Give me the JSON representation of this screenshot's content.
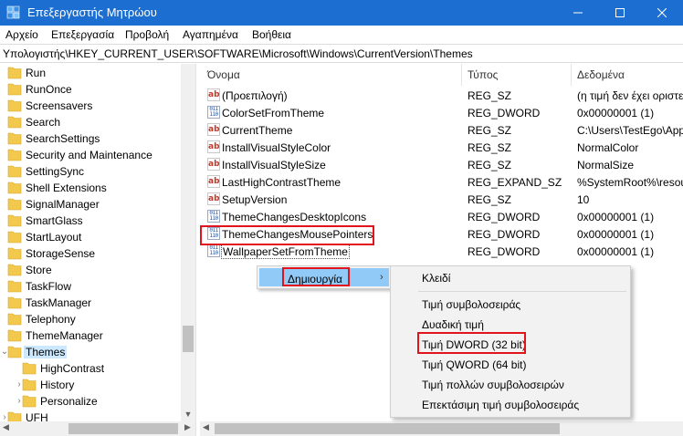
{
  "window": {
    "title": "Επεξεργαστής Μητρώου",
    "controls": {
      "minimize": "—",
      "maximize": "☐",
      "close": "✕"
    }
  },
  "menu": [
    "Αρχείο",
    "Επεξεργασία",
    "Προβολή",
    "Αγαπημένα",
    "Βοήθεια"
  ],
  "address": "Υπολογιστής\\HKEY_CURRENT_USER\\SOFTWARE\\Microsoft\\Windows\\CurrentVersion\\Themes",
  "tree": {
    "items": [
      {
        "label": "Run",
        "level": 0,
        "expander": ""
      },
      {
        "label": "RunOnce",
        "level": 0,
        "expander": ""
      },
      {
        "label": "Screensavers",
        "level": 0,
        "expander": ""
      },
      {
        "label": "Search",
        "level": 0,
        "expander": ""
      },
      {
        "label": "SearchSettings",
        "level": 0,
        "expander": ""
      },
      {
        "label": "Security and Maintenance",
        "level": 0,
        "expander": ""
      },
      {
        "label": "SettingSync",
        "level": 0,
        "expander": ""
      },
      {
        "label": "Shell Extensions",
        "level": 0,
        "expander": ""
      },
      {
        "label": "SignalManager",
        "level": 0,
        "expander": ""
      },
      {
        "label": "SmartGlass",
        "level": 0,
        "expander": ""
      },
      {
        "label": "StartLayout",
        "level": 0,
        "expander": ""
      },
      {
        "label": "StorageSense",
        "level": 0,
        "expander": ""
      },
      {
        "label": "Store",
        "level": 0,
        "expander": ""
      },
      {
        "label": "TaskFlow",
        "level": 0,
        "expander": ""
      },
      {
        "label": "TaskManager",
        "level": 0,
        "expander": ""
      },
      {
        "label": "Telephony",
        "level": 0,
        "expander": ""
      },
      {
        "label": "ThemeManager",
        "level": 0,
        "expander": ""
      },
      {
        "label": "Themes",
        "level": 0,
        "expander": "⌄",
        "selected": true
      },
      {
        "label": "HighContrast",
        "level": 1,
        "expander": ""
      },
      {
        "label": "History",
        "level": 1,
        "expander": "›"
      },
      {
        "label": "Personalize",
        "level": 1,
        "expander": "›"
      },
      {
        "label": "UFH",
        "level": 0,
        "expander": "›"
      }
    ]
  },
  "columns": {
    "name": "Όνομα",
    "type": "Τύπος",
    "data": "Δεδομένα"
  },
  "values": [
    {
      "icon": "string",
      "name": "(Προεπιλογή)",
      "type": "REG_SZ",
      "data": "(η τιμή δεν έχει οριστεί)"
    },
    {
      "icon": "binary",
      "name": "ColorSetFromTheme",
      "type": "REG_DWORD",
      "data": "0x00000001 (1)"
    },
    {
      "icon": "string",
      "name": "CurrentTheme",
      "type": "REG_SZ",
      "data": "C:\\Users\\TestEgo\\AppData"
    },
    {
      "icon": "string",
      "name": "InstallVisualStyleColor",
      "type": "REG_SZ",
      "data": "NormalColor"
    },
    {
      "icon": "string",
      "name": "InstallVisualStyleSize",
      "type": "REG_SZ",
      "data": "NormalSize"
    },
    {
      "icon": "string",
      "name": "LastHighContrastTheme",
      "type": "REG_EXPAND_SZ",
      "data": "%SystemRoot%\\resources"
    },
    {
      "icon": "string",
      "name": "SetupVersion",
      "type": "REG_SZ",
      "data": "10"
    },
    {
      "icon": "binary",
      "name": "ThemeChangesDesktopIcons",
      "type": "REG_DWORD",
      "data": "0x00000001 (1)"
    },
    {
      "icon": "binary",
      "name": "ThemeChangesMousePointers",
      "type": "REG_DWORD",
      "data": "0x00000001 (1)",
      "highlighted": true
    },
    {
      "icon": "binary",
      "name": "WallpaperSetFromTheme",
      "type": "REG_DWORD",
      "data": "0x00000001 (1)",
      "focused": true
    }
  ],
  "context_menu": {
    "new_label": "Δημιουργία",
    "submenu": [
      {
        "label": "Κλειδί"
      },
      {
        "label": "Τιμή συμβολοσειράς"
      },
      {
        "label": "Δυαδική τιμή"
      },
      {
        "label": "Τιμή DWORD (32 bit)",
        "highlighted": true
      },
      {
        "label": "Τιμή QWORD (64 bit)"
      },
      {
        "label": "Τιμή πολλών συμβολοσειρών"
      },
      {
        "label": "Επεκτάσιμη τιμή συμβολοσειράς"
      }
    ]
  },
  "colors": {
    "titlebar": "#1c6fd1",
    "selection": "#cce8ff",
    "menu_highlight": "#91c9f7",
    "annotation_red": "#e0141a",
    "folder": "#f2c94c"
  }
}
